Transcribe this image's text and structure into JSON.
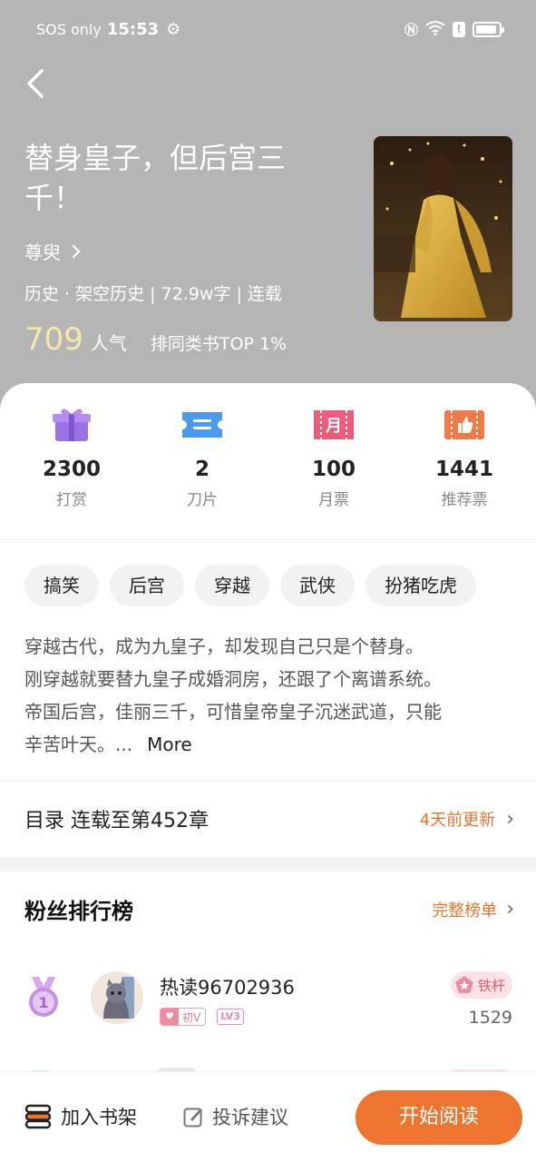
{
  "status_bar": {
    "carrier": "SOS only",
    "time": "15:53",
    "icons": [
      "gear-icon",
      "nfc-icon",
      "wifi-icon",
      "alert-icon",
      "battery-icon"
    ]
  },
  "header": {
    "back_icon": "chevron-left-icon",
    "title": "替身皇子，但后宫三千！",
    "author": "尊臾",
    "meta": "历史 · 架空历史 | 72.9w字 | 连载",
    "popularity_value": "709",
    "popularity_label": "人气",
    "rank_text": "排同类书TOP 1%"
  },
  "stats": [
    {
      "icon": "gift-icon",
      "value": "2300",
      "label": "打赏",
      "color": "#9b72e6"
    },
    {
      "icon": "blade-ticket-icon",
      "value": "2",
      "label": "刀片",
      "color": "#4a9bef"
    },
    {
      "icon": "monthly-ticket-icon",
      "value": "100",
      "label": "月票",
      "color": "#ef5b7a"
    },
    {
      "icon": "recommend-ticket-icon",
      "value": "1441",
      "label": "推荐票",
      "color": "#f07a45"
    }
  ],
  "tags": [
    "搞笑",
    "后宫",
    "穿越",
    "武侠",
    "扮猪吃虎"
  ],
  "description": {
    "lines": [
      "穿越古代，成为九皇子，却发现自己只是个替身。",
      "刚穿越就要替九皇子成婚洞房，还跟了个离谱系统。",
      "帝国后宫，佳丽三千，可惜皇帝皇子沉迷武道，只能",
      "辛苦叶天。..."
    ],
    "more": "More"
  },
  "toc": {
    "label": "目录 连载至第452章",
    "updated": "4天前更新"
  },
  "fans": {
    "title": "粉丝排行榜",
    "full_list": "完整榜单",
    "entries": [
      {
        "rank": "1",
        "name": "热读96702936",
        "vip": "初V",
        "level": "LV3",
        "title_badge": "铁杆",
        "score": "1529"
      }
    ]
  },
  "bottom_bar": {
    "shelf": "加入书架",
    "report": "投诉建议",
    "read": "开始阅读"
  },
  "colors": {
    "accent": "#ee7530",
    "header_bg": "#b5b5b5",
    "popularity": "#f6e6a8"
  }
}
